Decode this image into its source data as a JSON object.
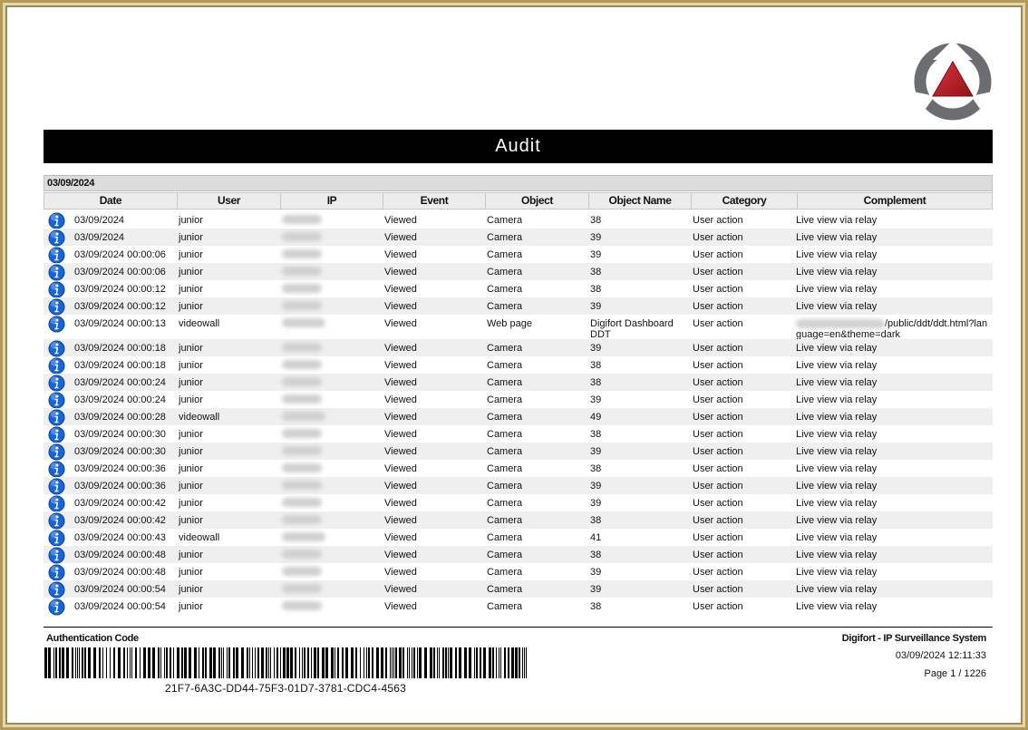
{
  "report": {
    "title": "Audit",
    "group_date": "03/09/2024"
  },
  "columns": [
    "Date",
    "User",
    "IP",
    "Event",
    "Object",
    "Object Name",
    "Category",
    "Complement"
  ],
  "rows": [
    {
      "date": "03/09/2024",
      "user": "junior",
      "event": "Viewed",
      "object": "Camera",
      "object_name": "38",
      "category": "User action",
      "complement": "Live view via relay"
    },
    {
      "date": "03/09/2024",
      "user": "junior",
      "event": "Viewed",
      "object": "Camera",
      "object_name": "39",
      "category": "User action",
      "complement": "Live view via relay"
    },
    {
      "date": "03/09/2024 00:00:06",
      "user": "junior",
      "event": "Viewed",
      "object": "Camera",
      "object_name": "39",
      "category": "User action",
      "complement": "Live view via relay"
    },
    {
      "date": "03/09/2024 00:00:06",
      "user": "junior",
      "event": "Viewed",
      "object": "Camera",
      "object_name": "38",
      "category": "User action",
      "complement": "Live view via relay"
    },
    {
      "date": "03/09/2024 00:00:12",
      "user": "junior",
      "event": "Viewed",
      "object": "Camera",
      "object_name": "38",
      "category": "User action",
      "complement": "Live view via relay"
    },
    {
      "date": "03/09/2024 00:00:12",
      "user": "junior",
      "event": "Viewed",
      "object": "Camera",
      "object_name": "39",
      "category": "User action",
      "complement": "Live view via relay"
    },
    {
      "date": "03/09/2024 00:00:13",
      "user": "videowall",
      "event": "Viewed",
      "object": "Web page",
      "object_name": "Digifort Dashboard DDT",
      "category": "User action",
      "complement": "/public/ddt/ddt.html?language=en&theme=dark",
      "tall": true
    },
    {
      "date": "03/09/2024 00:00:18",
      "user": "junior",
      "event": "Viewed",
      "object": "Camera",
      "object_name": "39",
      "category": "User action",
      "complement": "Live view via relay"
    },
    {
      "date": "03/09/2024 00:00:18",
      "user": "junior",
      "event": "Viewed",
      "object": "Camera",
      "object_name": "38",
      "category": "User action",
      "complement": "Live view via relay"
    },
    {
      "date": "03/09/2024 00:00:24",
      "user": "junior",
      "event": "Viewed",
      "object": "Camera",
      "object_name": "38",
      "category": "User action",
      "complement": "Live view via relay"
    },
    {
      "date": "03/09/2024 00:00:24",
      "user": "junior",
      "event": "Viewed",
      "object": "Camera",
      "object_name": "39",
      "category": "User action",
      "complement": "Live view via relay"
    },
    {
      "date": "03/09/2024 00:00:28",
      "user": "videowall",
      "event": "Viewed",
      "object": "Camera",
      "object_name": "49",
      "category": "User action",
      "complement": "Live view via relay"
    },
    {
      "date": "03/09/2024 00:00:30",
      "user": "junior",
      "event": "Viewed",
      "object": "Camera",
      "object_name": "38",
      "category": "User action",
      "complement": "Live view via relay"
    },
    {
      "date": "03/09/2024 00:00:30",
      "user": "junior",
      "event": "Viewed",
      "object": "Camera",
      "object_name": "39",
      "category": "User action",
      "complement": "Live view via relay"
    },
    {
      "date": "03/09/2024 00:00:36",
      "user": "junior",
      "event": "Viewed",
      "object": "Camera",
      "object_name": "38",
      "category": "User action",
      "complement": "Live view via relay"
    },
    {
      "date": "03/09/2024 00:00:36",
      "user": "junior",
      "event": "Viewed",
      "object": "Camera",
      "object_name": "39",
      "category": "User action",
      "complement": "Live view via relay"
    },
    {
      "date": "03/09/2024 00:00:42",
      "user": "junior",
      "event": "Viewed",
      "object": "Camera",
      "object_name": "39",
      "category": "User action",
      "complement": "Live view via relay"
    },
    {
      "date": "03/09/2024 00:00:42",
      "user": "junior",
      "event": "Viewed",
      "object": "Camera",
      "object_name": "38",
      "category": "User action",
      "complement": "Live view via relay"
    },
    {
      "date": "03/09/2024 00:00:43",
      "user": "videowall",
      "event": "Viewed",
      "object": "Camera",
      "object_name": "41",
      "category": "User action",
      "complement": "Live view via relay"
    },
    {
      "date": "03/09/2024 00:00:48",
      "user": "junior",
      "event": "Viewed",
      "object": "Camera",
      "object_name": "38",
      "category": "User action",
      "complement": "Live view via relay"
    },
    {
      "date": "03/09/2024 00:00:48",
      "user": "junior",
      "event": "Viewed",
      "object": "Camera",
      "object_name": "39",
      "category": "User action",
      "complement": "Live view via relay"
    },
    {
      "date": "03/09/2024 00:00:54",
      "user": "junior",
      "event": "Viewed",
      "object": "Camera",
      "object_name": "39",
      "category": "User action",
      "complement": "Live view via relay"
    },
    {
      "date": "03/09/2024 00:00:54",
      "user": "junior",
      "event": "Viewed",
      "object": "Camera",
      "object_name": "38",
      "category": "User action",
      "complement": "Live view via relay"
    }
  ],
  "footer": {
    "auth_label": "Authentication Code",
    "auth_code": "21F7-6A3C-DD44-75F3-01D7-3781-CDC4-4563",
    "system_name": "Digifort - IP Surveillance System",
    "print_datetime": "03/09/2024 12:11:33",
    "page": "Page 1 / 1226"
  },
  "icons": {
    "row_icon": "info-icon",
    "logo": "digifort-logo"
  },
  "colors": {
    "info_blue": "#1565d8",
    "logo_red": "#b3202a",
    "logo_gray": "#6b6d70"
  }
}
